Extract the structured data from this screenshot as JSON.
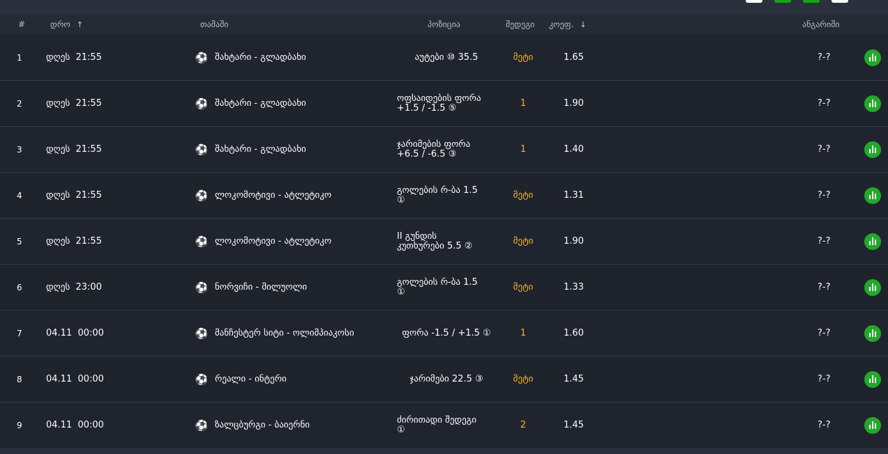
{
  "header": {
    "num": "#",
    "time": "დრო",
    "time_sort": "↑",
    "game": "თამაში",
    "position": "პოზიცია",
    "result": "შედეგი",
    "odds": "კოეფ.",
    "odds_sort": "↓",
    "report": "ანგარიში"
  },
  "icons": {
    "sport": "soccer-ball-icon",
    "stats": "stats-chart-icon"
  },
  "colors": {
    "result": "#f5b81c",
    "stats_button": "#22a82a",
    "top_button_green": "#16a316"
  },
  "rows": [
    {
      "num": "1",
      "date": "დღეს  21:55",
      "match": "შახტარი - გლადბახი",
      "position": "აუტები ⑩ 35.5",
      "result": "მეტი",
      "odds": "1.65",
      "report": "?-?"
    },
    {
      "num": "2",
      "date": "დღეს  21:55",
      "match": "შახტარი - გლადბახი",
      "position": "ოფსაიდების ფორა\n+1.5 / -1.5 ⑤",
      "result": "1",
      "odds": "1.90",
      "report": "?-?"
    },
    {
      "num": "3",
      "date": "დღეს  21:55",
      "match": "შახტარი - გლადბახი",
      "position": "ჯარიმების ფორა\n+6.5 / -6.5 ③",
      "result": "1",
      "odds": "1.40",
      "report": "?-?"
    },
    {
      "num": "4",
      "date": "დღეს  21:55",
      "match": "ლოკომოტივი - ატლეტიკო",
      "position": "გოლების რ-ბა 1.5\n①",
      "result": "მეტი",
      "odds": "1.31",
      "report": "?-?"
    },
    {
      "num": "5",
      "date": "დღეს  21:55",
      "match": "ლოკომოტივი - ატლეტიკო",
      "position": "II გუნდის\nკუთხურები 5.5 ②",
      "result": "მეტი",
      "odds": "1.90",
      "report": "?-?"
    },
    {
      "num": "6",
      "date": "დღეს  23:00",
      "match": "ნორვიჩი - მილუოლი",
      "position": "გოლების რ-ბა 1.5\n①",
      "result": "მეტი",
      "odds": "1.33",
      "report": "?-?"
    },
    {
      "num": "7",
      "date": "04.11  00:00",
      "match": "მანჩესტერ სიტი - ოლიმპიაკოსი",
      "position": "ფორა -1.5 / +1.5 ①",
      "result": "1",
      "odds": "1.60",
      "report": "?-?"
    },
    {
      "num": "8",
      "date": "04.11  00:00",
      "match": "რეალი - ინტერი",
      "position": "ჯარიმები 22.5 ③",
      "result": "მეტი",
      "odds": "1.45",
      "report": "?-?"
    },
    {
      "num": "9",
      "date": "04.11  00:00",
      "match": "ზალცბურგი - ბაიერნი",
      "position": "ძირითადი შედეგი\n①",
      "result": "2",
      "odds": "1.45",
      "report": "?-?"
    }
  ]
}
